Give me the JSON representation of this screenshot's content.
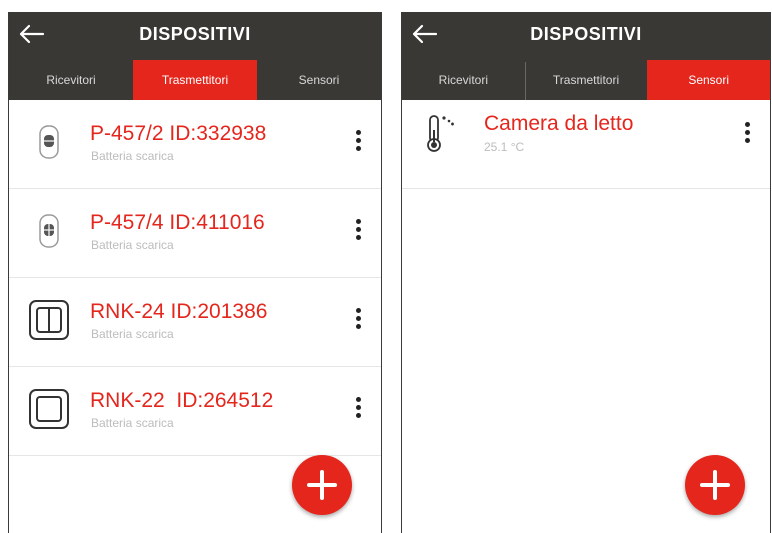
{
  "left_screen": {
    "header": {
      "title": "DISPOSITIVI",
      "back_icon": "arrow-left-icon"
    },
    "tabs": [
      {
        "label": "Ricevitori",
        "active": false
      },
      {
        "label": "Trasmettitori",
        "active": true
      },
      {
        "label": "Sensori",
        "active": false
      }
    ],
    "devices": [
      {
        "name": "P-457/2 ID:332938",
        "status": "Batteria scarica",
        "icon": "remote-control-icon"
      },
      {
        "name": "P-457/4 ID:411016",
        "status": "Batteria scarica",
        "icon": "remote-control-icon"
      },
      {
        "name": "RNK-24 ID:201386",
        "status": "Batteria scarica",
        "icon": "double-wall-switch-icon"
      },
      {
        "name": "RNK-22  ID:264512",
        "status": "Batteria scarica",
        "icon": "single-wall-switch-icon"
      }
    ],
    "fab_icon": "plus-icon"
  },
  "right_screen": {
    "header": {
      "title": "DISPOSITIVI",
      "back_icon": "arrow-left-icon"
    },
    "tabs": [
      {
        "label": "Ricevitori",
        "active": false
      },
      {
        "label": "Trasmettitori",
        "active": false
      },
      {
        "label": "Sensori",
        "active": true
      }
    ],
    "sensors": [
      {
        "name": "Camera da letto",
        "value": "25.1 °C",
        "icon": "thermometer-icon"
      }
    ],
    "fab_icon": "plus-icon"
  },
  "colors": {
    "accent": "#e4261d",
    "header_bg": "#3a3835",
    "muted_text": "#bcbcbc"
  }
}
